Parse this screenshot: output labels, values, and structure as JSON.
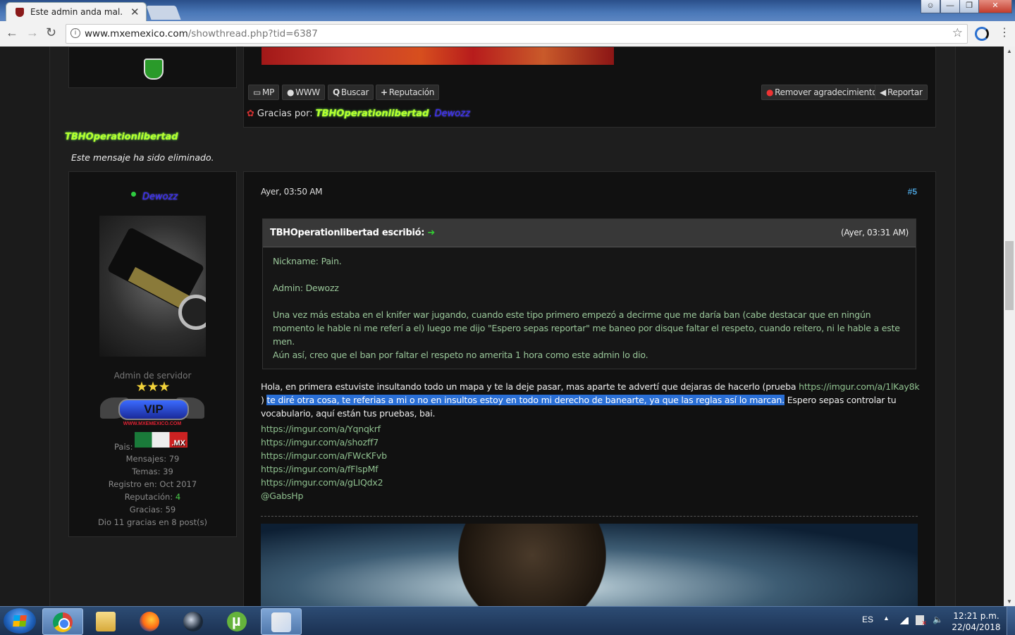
{
  "browser": {
    "tab_title": "Este admin anda mal.",
    "tab_close": "✕",
    "url_domain": "www.mxemexico.com",
    "url_path": "/showthread.php?tid=6387",
    "back": "←",
    "forward": "→",
    "reload": "↻",
    "star": "☆",
    "menu": "⋮",
    "info": "i"
  },
  "window_controls": {
    "minimize": "—",
    "maximize": "❐",
    "close": "✕"
  },
  "previous_post": {
    "buttons": [
      {
        "icon": "▭",
        "label": "MP"
      },
      {
        "icon": "●",
        "label": "WWW"
      },
      {
        "icon": "Q",
        "label": "Buscar"
      },
      {
        "icon": "+",
        "label": "Reputación"
      }
    ],
    "remove_thanks_label": "Remover agradecimiento",
    "report_label": "Reportar",
    "thanks_label": "Gracias por:",
    "thanks_users": [
      "TBHOperationlibertad",
      "Dewozz"
    ]
  },
  "deleted_post": {
    "username": "TBHOperationlibertad",
    "message": "Este mensaje ha sido eliminado."
  },
  "user": {
    "name": "Dewozz",
    "role": "Admin de servidor",
    "stars": "★★★",
    "vip_text": "VIP",
    "vip_site": "WWW.MXEMEXICO.COM",
    "country_label": "Pais:",
    "country_code": ".MX",
    "messages": "Mensajes: 79",
    "topics": "Temas: 39",
    "registered": "Registro en: Oct 2017",
    "reputation_label": "Reputación:",
    "reputation_value": "4",
    "thanks_received": "Gracias: 59",
    "thanks_given": "Dio 11 gracias en 8 post(s)"
  },
  "post": {
    "date": "Ayer, 03:50 AM",
    "number": "#5",
    "quote": {
      "author": "TBHOperationlibertad escribió:",
      "arrow": "➜",
      "time": "(Ayer, 03:31 AM)",
      "lines": [
        "Nickname: Pain.",
        "Admin: Dewozz",
        "Una vez más estaba en el knifer war jugando, cuando este tipo primero empezó a decirme que me daría ban (cabe destacar que en ningún momento le hable ni me referí a el) luego me dijo \"Espero sepas reportar\" me baneo por disque faltar el respeto, cuando reitero, ni le hable a este men.",
        "Aún así, creo que el ban por faltar el respeto no amerita 1 hora como este admin lo dio."
      ]
    },
    "body_part1": "Hola, en primera estuviste insultando todo un mapa y te la deje pasar, mas aparte te advertí que dejaras de hacerlo (prueba ",
    "body_link": "https://imgur.com/a/1lKay8k",
    "body_part2": " ) ",
    "body_highlight": "te diré otra cosa, te referias a mi o no en insultos estoy en todo mi derecho de banearte, ya que las reglas así lo marcan.",
    "body_part3": " Espero sepas controlar tu vocabulario, aquí están tus pruebas, bai.",
    "links": [
      "https://imgur.com/a/Yqnqkrf",
      "https://imgur.com/a/shozff7",
      "https://imgur.com/a/FWcKFvb",
      "https://imgur.com/a/fFlspMf",
      "https://imgur.com/a/gLIQdx2",
      "@GabsHp"
    ]
  },
  "taskbar": {
    "language": "ES",
    "time": "12:21 p.m.",
    "date": "22/04/2018"
  }
}
